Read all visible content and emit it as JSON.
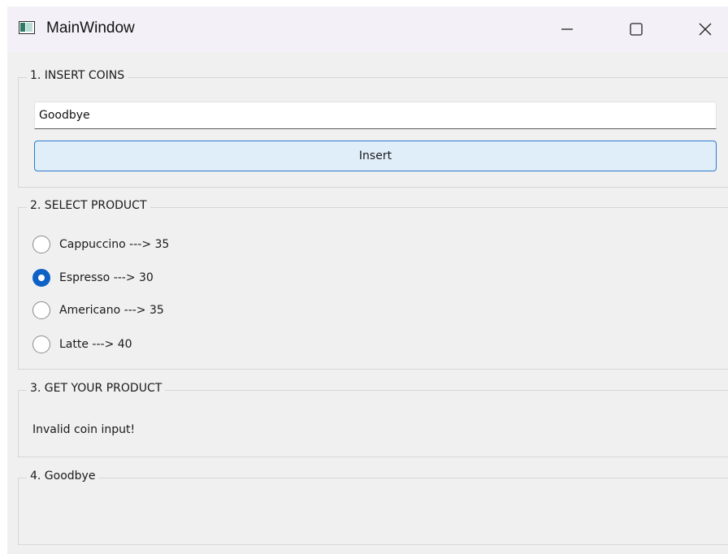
{
  "window": {
    "title": "MainWindow",
    "controls": {
      "minimize": "minimize-icon",
      "maximize": "maximize-icon",
      "close": "close-icon"
    }
  },
  "insert_coins": {
    "title": "1. INSERT COINS",
    "input_value": "Goodbye",
    "button_label": "Insert"
  },
  "select_product": {
    "title": "2. SELECT PRODUCT",
    "options": [
      {
        "label": "Cappuccino ---> 35",
        "checked": false
      },
      {
        "label": "Espresso ---> 30",
        "checked": true
      },
      {
        "label": "Americano ---> 35",
        "checked": false
      },
      {
        "label": "Latte ---> 40",
        "checked": false
      }
    ]
  },
  "get_product": {
    "title": "3. GET YOUR PRODUCT",
    "message": "Invalid coin input!"
  },
  "goodbye": {
    "title": "4. Goodbye"
  },
  "colors": {
    "accent": "#0f62c5",
    "button_bg": "#e0eef9",
    "button_border": "#2d7bd0",
    "window_bg": "#f0f0f0",
    "titlebar_bg": "#f3f1f7"
  }
}
